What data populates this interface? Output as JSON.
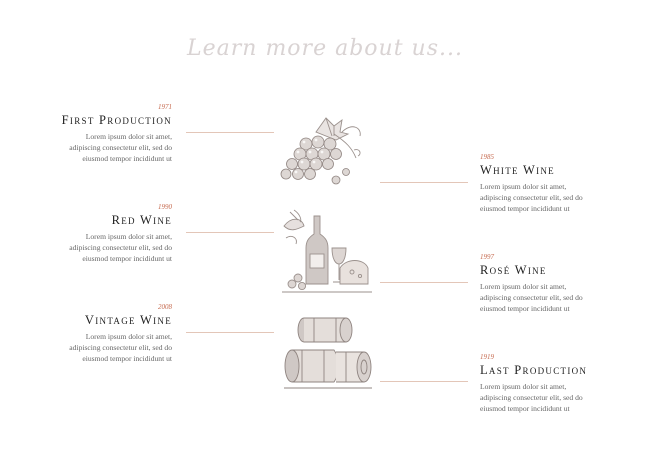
{
  "heading": "Learn more about us...",
  "timeline": {
    "left": [
      {
        "year": "1971",
        "title": "First Production",
        "desc": [
          "Lorem ipsum dolor sit amet,",
          "adipiscing consectetur elit, sed do",
          "eiusmod tempor incididunt ut"
        ]
      },
      {
        "year": "1990",
        "title": "Red Wine",
        "desc": [
          "Lorem ipsum dolor sit amet,",
          "adipiscing consectetur elit, sed do",
          "eiusmod tempor incididunt ut"
        ]
      },
      {
        "year": "2008",
        "title": "Vintage Wine",
        "desc": [
          "Lorem ipsum dolor sit amet,",
          "adipiscing consectetur elit, sed do",
          "eiusmod tempor incididunt ut"
        ]
      }
    ],
    "right": [
      {
        "year": "1985",
        "title": "White Wine",
        "desc": [
          "Lorem ipsum dolor sit amet,",
          "adipiscing consectetur elit, sed do",
          "eiusmod tempor incididunt ut"
        ]
      },
      {
        "year": "1997",
        "title": "Rosé Wine",
        "desc": [
          "Lorem ipsum dolor sit amet,",
          "adipiscing consectetur elit, sed do",
          "eiusmod tempor incididunt ut"
        ]
      },
      {
        "year": "1919",
        "title": "Last Production",
        "desc": [
          "Lorem ipsum dolor sit amet,",
          "adipiscing consectetur elit, sed do",
          "eiusmod tempor incididunt ut"
        ]
      }
    ]
  },
  "illustrations": [
    "grapes-illustration",
    "wine-bottle-cheese-illustration",
    "wine-barrels-illustration"
  ],
  "colors": {
    "accent": "#c66a4f",
    "connector": "#e3c6b8",
    "sketch": "#9b918d",
    "heading": "#d9d3d3"
  }
}
